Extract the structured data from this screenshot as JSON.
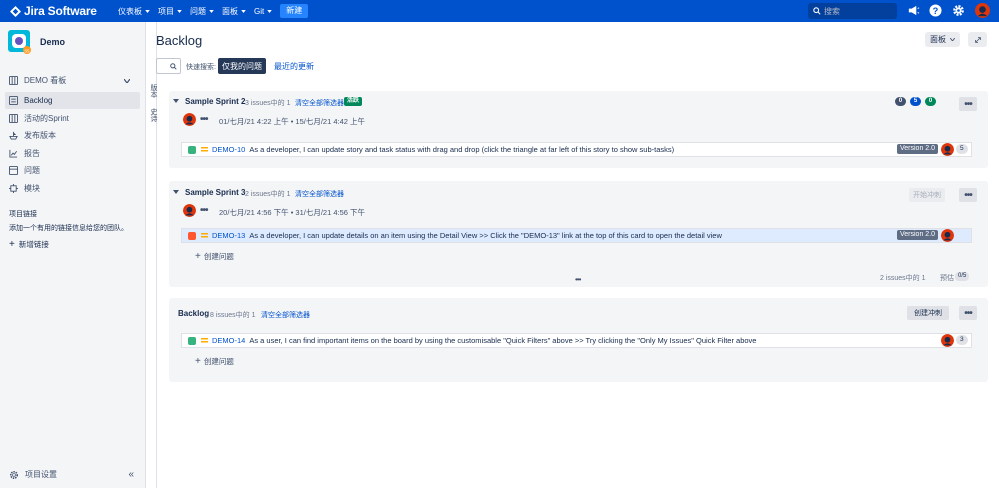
{
  "nav": {
    "logo_text": "Jira Software",
    "menu": [
      {
        "label": "仪表板"
      },
      {
        "label": "项目"
      },
      {
        "label": "问题"
      },
      {
        "label": "面板"
      },
      {
        "label": "Git"
      }
    ],
    "create_label": "新建",
    "search_placeholder": "搜索",
    "icons": [
      "megaphone-icon",
      "help-icon",
      "settings-icon",
      "user-avatar"
    ]
  },
  "sidebar": {
    "project_name": "Demo",
    "board_selector": "DEMO 看板",
    "items": [
      {
        "label": "Backlog",
        "icon": "backlog-icon",
        "active": true
      },
      {
        "label": "活动的Sprint",
        "icon": "board-icon"
      },
      {
        "label": "发布版本",
        "icon": "ship-icon"
      },
      {
        "label": "报告",
        "icon": "chart-icon"
      },
      {
        "label": "问题",
        "icon": "issues-icon"
      },
      {
        "label": "模块",
        "icon": "components-icon"
      }
    ],
    "project_links_title": "项目链接",
    "project_links_desc": "添加一个有用的链接信息给您的团队。",
    "add_link_label": "新增链接",
    "settings_label": "项目设置"
  },
  "side_strip": {
    "versions_label": "版本",
    "epics_label": "史诗"
  },
  "page": {
    "title": "Backlog",
    "board_button": "面板",
    "quick_filter_label": "快速搜索:",
    "filter_my_issues": "仅我的问题",
    "filter_recent": "最近的更新"
  },
  "sprint2": {
    "title": "Sample Sprint 2",
    "count": "3 issues中的 1",
    "clear_filter": "清空全部筛选器",
    "status": "活跃",
    "dates": "01/七月/21 4:22 上午 • 15/七月/21 4:42 上午",
    "pills": [
      {
        "value": "0",
        "color": "#42526e"
      },
      {
        "value": "5",
        "color": "#0052cc"
      },
      {
        "value": "0",
        "color": "#00875a"
      }
    ],
    "issues": [
      {
        "key": "DEMO-10",
        "summary": "As a developer, I can update story and task status with drag and drop (click the triangle at far left of this story to show sub-tasks)",
        "type": "story",
        "version": "Version 2.0",
        "estimate": "5"
      }
    ]
  },
  "sprint3": {
    "title": "Sample Sprint 3",
    "count": "2 issues中的 1",
    "clear_filter": "清空全部筛选器",
    "dates": "20/七月/21 4:56 下午 • 31/七月/21 4:56 下午",
    "start_label": "开始冲刺",
    "issues": [
      {
        "key": "DEMO-13",
        "summary": "As a developer, I can update details on an item using the Detail View >> Click the \"DEMO-13\" link at the top of this card to open the detail view",
        "type": "bug",
        "version": "Version 2.0"
      }
    ],
    "create_issue": "创建问题",
    "footer_count": "2 issues中的 1",
    "footer_est_label": "预估",
    "footer_est_value": "0/5"
  },
  "backlog": {
    "title": "Backlog",
    "count": "8 issues中的 1",
    "clear_filter": "清空全部筛选器",
    "create_sprint": "创建冲刺",
    "issues": [
      {
        "key": "DEMO-14",
        "summary": "As a user, I can find important items on the board by using the customisable \"Quick Filters\" above >> Try clicking the \"Only My Issues\" Quick Filter above",
        "type": "story",
        "estimate": "3"
      }
    ],
    "create_issue": "创建问题"
  },
  "colors": {
    "nav": "#0052cc",
    "story": "#36b37e",
    "bug": "#ff5630",
    "priority": "#ffab00",
    "avatar": "#de350b"
  }
}
